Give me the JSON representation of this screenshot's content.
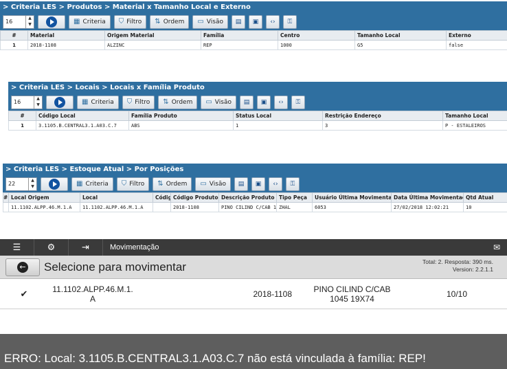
{
  "panel1": {
    "breadcrumb": "> Criteria LES > Produtos > Material x Tamanho Local e Externo",
    "spinner_value": "16",
    "buttons": {
      "criteria": "Criteria",
      "filtro": "Filtro",
      "ordem": "Ordem",
      "visao": "Visão"
    },
    "columns": [
      "#",
      "Material",
      "Origem Material",
      "Família",
      "Centro",
      "Tamanho Local",
      "Externo"
    ],
    "rows": [
      [
        "1",
        "2018-1108",
        "ALZINC",
        "REP",
        "1000",
        "G5",
        "false"
      ]
    ]
  },
  "panel2": {
    "breadcrumb": "> Criteria LES > Locais > Locais x Família Produto",
    "spinner_value": "16",
    "buttons": {
      "criteria": "Criteria",
      "filtro": "Filtro",
      "ordem": "Ordem",
      "visao": "Visão"
    },
    "columns": [
      "#",
      "Código Local",
      "Família Produto",
      "Status Local",
      "Restrição Endereço",
      "Tamanho Local"
    ],
    "rows": [
      [
        "1",
        "3.1105.B.CENTRAL3.1.A03.C.7",
        "ABS",
        "1",
        "3",
        "P - ESTALEIROS"
      ]
    ]
  },
  "panel3": {
    "breadcrumb": "> Criteria LES > Estoque Atual > Por Posições",
    "spinner_value": "22",
    "buttons": {
      "criteria": "Criteria",
      "filtro": "Filtro",
      "ordem": "Ordem",
      "visao": "Visão"
    },
    "columns": [
      "#",
      "Local Origem",
      "Local",
      "Códig",
      "Código Produto",
      "Descrição Produto",
      "Tipo Peça",
      "Usuário Última Movimentaçã",
      "Data Última Movimentaçã",
      "Qtd Atual"
    ],
    "rows": [
      [
        "",
        "11.1102.ALPP.46.M.1.A",
        "11.1102.ALPP.46.M.1.A",
        "",
        "2018-1108",
        "PINO CILIND C/CAB 1(",
        "ZHAL",
        "6053",
        "27/02/2018 12:02:21",
        "10"
      ]
    ]
  },
  "mobile": {
    "app_title": "Movimentação",
    "header_title": "Selecione para movimentar",
    "info_line1": "Total: 2. Resposta: 390 ms.",
    "info_line2": "Version: 2.2.1.1",
    "row": {
      "local_line1": "11.1102.ALPP.46.M.1.",
      "local_line2": "A",
      "material": "2018-1108",
      "desc_line1": "PINO CILIND C/CAB",
      "desc_line2": "1045 19X74",
      "qty": "10/10"
    }
  },
  "error": {
    "message": "ERRO: Local: 3.1105.B.CENTRAL3.1.A03.C.7 não está vinculada à família: REP!"
  }
}
